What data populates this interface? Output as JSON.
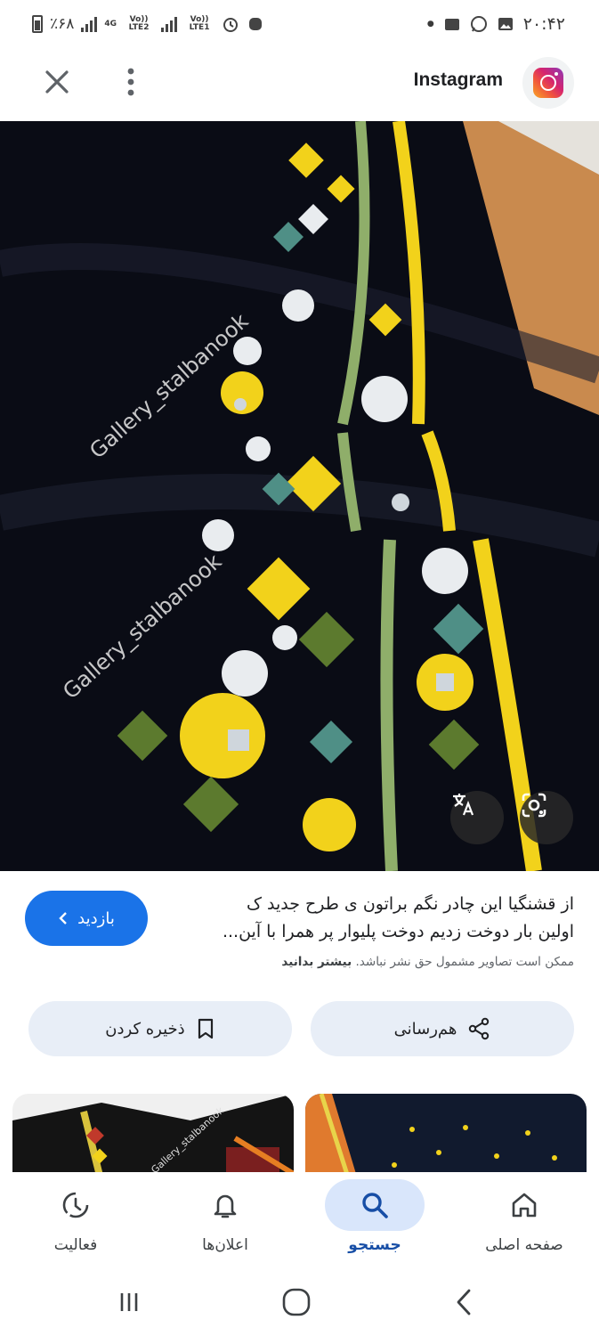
{
  "status_bar": {
    "time": "۲۰:۴۲",
    "battery": "٪۶۸",
    "sim1_label": "Vo)) LTE1",
    "sim2_label": "Vo)) LTE2",
    "network": "4G"
  },
  "header": {
    "site_name": "Instagram"
  },
  "image": {
    "watermark_1": "Gallery_stalbanook",
    "watermark_2": "Gallery_stalbanook"
  },
  "info": {
    "title_line1": "از قشنگیا این چادر نگم براتون ی طرح جدید ک",
    "title_line2": "اولین بار دوخت زدیم دوخت پلیوار پر همرا با آین...",
    "disclaimer": "ممکن است تصاویر مشمول حق نشر نباشد.",
    "learn_more": "بیشتر بدانید",
    "visit_label": "بازدید"
  },
  "actions": {
    "share_label": "هم‌رسانی",
    "save_label": "ذخیره کردن"
  },
  "related": {
    "watermark": "Gallery_stalbanook"
  },
  "bottom_nav": {
    "home": "صفحه اصلی",
    "search": "جستجو",
    "notifications": "اعلان‌ها",
    "activity": "فعالیت"
  },
  "colors": {
    "accent": "#1a73e8",
    "pill_bg": "#e8eef7",
    "nav_active_bg": "#d9e6fb"
  }
}
